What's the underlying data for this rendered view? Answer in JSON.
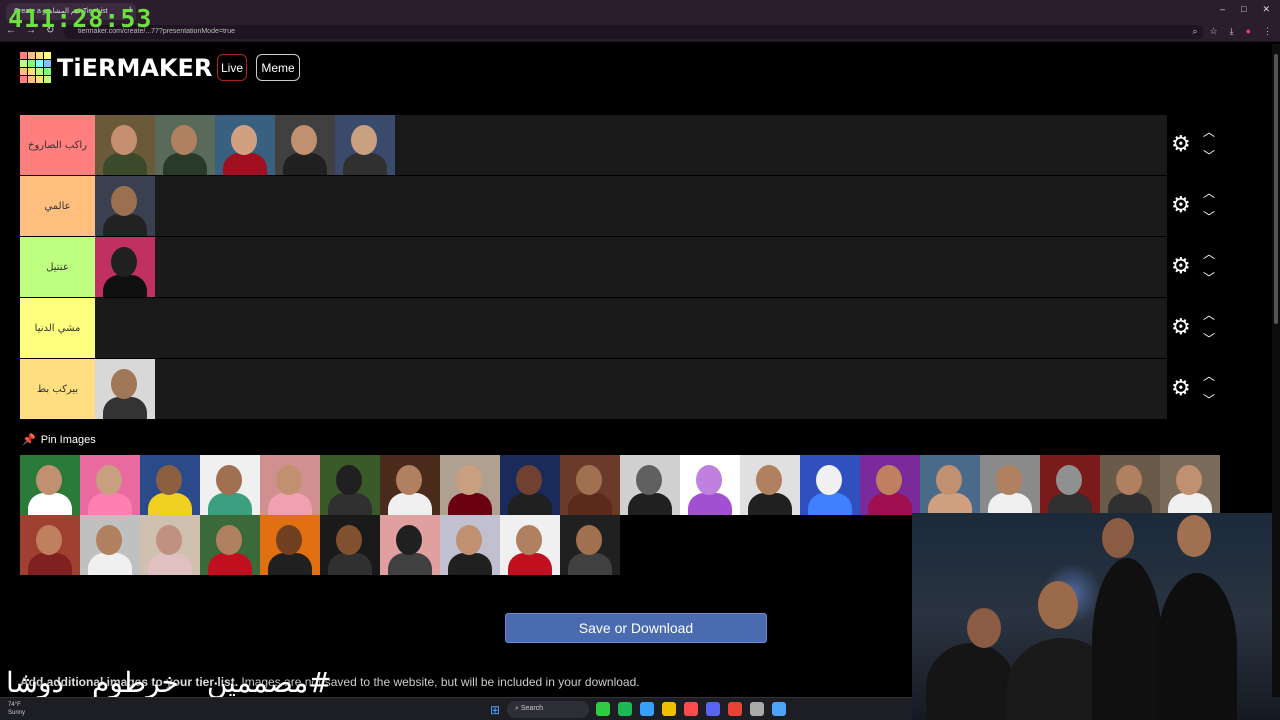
{
  "browser": {
    "tab_title": "Create a قيم المشاهير Tier List",
    "new_tab": "+",
    "url": "tiermaker.com/create/...77?presentationMode=true",
    "controls": [
      "–",
      "□",
      "✕"
    ]
  },
  "timer": "411:28:53",
  "header": {
    "logo_text": "TiERMAKER",
    "live_label": "Live",
    "meme_label": "Meme",
    "logo_colors": [
      "#ff7f7f",
      "#ffbf7f",
      "#ffdf7f",
      "#ffff7f",
      "#bfff7f",
      "#7fff7f",
      "#7fffff",
      "#7fbfff",
      "#ffbf7f",
      "#ffdf7f",
      "#bfff7f",
      "#7fff7f",
      "#ff7f7f",
      "#ffbf7f",
      "#ffdf7f",
      "#bfff7f"
    ]
  },
  "tiers": [
    {
      "label": "راكب الصاروخ",
      "color": "#ff7f7f",
      "items": [
        {
          "bg": "#6b5a3a",
          "face": "#c49070",
          "body": "#3a4a2a"
        },
        {
          "bg": "#5a6a5a",
          "face": "#b08060",
          "body": "#2a3a2a"
        },
        {
          "bg": "#3a6080",
          "face": "#d0a080",
          "body": "#a01020"
        },
        {
          "bg": "#404040",
          "face": "#c09070",
          "body": "#202020"
        },
        {
          "bg": "#3a4a6a",
          "face": "#c8a080",
          "body": "#303030"
        }
      ]
    },
    {
      "label": "عالمي",
      "color": "#ffbf7f",
      "items": [
        {
          "bg": "#3a4050",
          "face": "#9a7050",
          "body": "#222"
        }
      ]
    },
    {
      "label": "عنتيل",
      "color": "#bfff7f",
      "items": [
        {
          "bg": "#c03060",
          "face": "#202020",
          "body": "#101010"
        }
      ]
    },
    {
      "label": "مشي الدنيا",
      "color": "#ffff7f",
      "items": []
    },
    {
      "label": "بيركب بط",
      "color": "#ffdf7f",
      "items": [
        {
          "bg": "#d8d8d8",
          "face": "#a07858",
          "body": "#333"
        }
      ]
    }
  ],
  "pin": {
    "label": "Pin Images",
    "icon": "pin-icon"
  },
  "pool": [
    {
      "bg": "#2a7a3a",
      "face": "#c09070",
      "body": "#ffffff"
    },
    {
      "bg": "#e86aa0",
      "face": "#c8a080",
      "body": "#ff7fb0"
    },
    {
      "bg": "#2a4a8a",
      "face": "#8a6040",
      "body": "#f0d020"
    },
    {
      "bg": "#f0f0f0",
      "face": "#a07050",
      "body": "#3aa080"
    },
    {
      "bg": "#d09090",
      "face": "#c09070",
      "body": "#f0a0b0"
    },
    {
      "bg": "#3a5a2a",
      "face": "#202020",
      "body": "#303030"
    },
    {
      "bg": "#4a2a1a",
      "face": "#b08060",
      "body": "#f0f0f0"
    },
    {
      "bg": "#b0a090",
      "face": "#c8a080",
      "body": "#6a0010"
    },
    {
      "bg": "#1a2a5a",
      "face": "#704030",
      "body": "#202020"
    },
    {
      "bg": "#6a3a2a",
      "face": "#a07050",
      "body": "#5a2a1a"
    },
    {
      "bg": "#d0d0d0",
      "face": "#606060",
      "body": "#202020"
    },
    {
      "bg": "#ffffff",
      "face": "#c080e0",
      "body": "#a050d0"
    },
    {
      "bg": "#e0e0e0",
      "face": "#b08060",
      "body": "#202020"
    },
    {
      "bg": "#3050c0",
      "face": "#f0f0f0",
      "body": "#4080ff"
    },
    {
      "bg": "#7a2a9a",
      "face": "#c08060",
      "body": "#a01050"
    },
    {
      "bg": "#4a6a8a",
      "face": "#c09070",
      "body": "#d0a080"
    },
    {
      "bg": "#8a8a8a",
      "face": "#b08060",
      "body": "#f0f0f0"
    },
    {
      "bg": "#7a1a1a",
      "face": "#909090",
      "body": "#303030"
    },
    {
      "bg": "#6a5a4a",
      "face": "#b08060",
      "body": "#303030"
    },
    {
      "bg": "#7a6a5a",
      "face": "#c09070",
      "body": "#f0f0f0"
    },
    {
      "bg": "#a04030",
      "face": "#c08060",
      "body": "#802020"
    },
    {
      "bg": "#c0c0c0",
      "face": "#b08060",
      "body": "#f0f0f0"
    },
    {
      "bg": "#d0c0b0",
      "face": "#c09080",
      "body": "#e0c0c0"
    },
    {
      "bg": "#3a6a3a",
      "face": "#b08060",
      "body": "#c01020"
    },
    {
      "bg": "#e07010",
      "face": "#704020",
      "body": "#202020"
    },
    {
      "bg": "#1a1a1a",
      "face": "#805030",
      "body": "#303030"
    },
    {
      "bg": "#e0a0a0",
      "face": "#202020",
      "body": "#404040"
    },
    {
      "bg": "#c0c0d0",
      "face": "#c09070",
      "body": "#202020"
    },
    {
      "bg": "#f0f0f0",
      "face": "#b08060",
      "body": "#c01020"
    },
    {
      "bg": "#202020",
      "face": "#a07050",
      "body": "#404040"
    }
  ],
  "save_button": "Save or Download",
  "note": {
    "bold": "Add additional images to your tier list.",
    "rest": " Images are not saved to the website, but will be included in your download."
  },
  "overlay_text": "#مصممين__خرطوم__دوشا",
  "taskbar": {
    "weather_temp": "74°F",
    "weather_desc": "Sunny",
    "search_label": "Search",
    "app_colors": [
      "#2ecc40",
      "#1db954",
      "#3aa0ff",
      "#f0c000",
      "#ff4d4d",
      "#5865f2",
      "#ea4335",
      "#aaaaaa",
      "#4ea3ff"
    ]
  }
}
